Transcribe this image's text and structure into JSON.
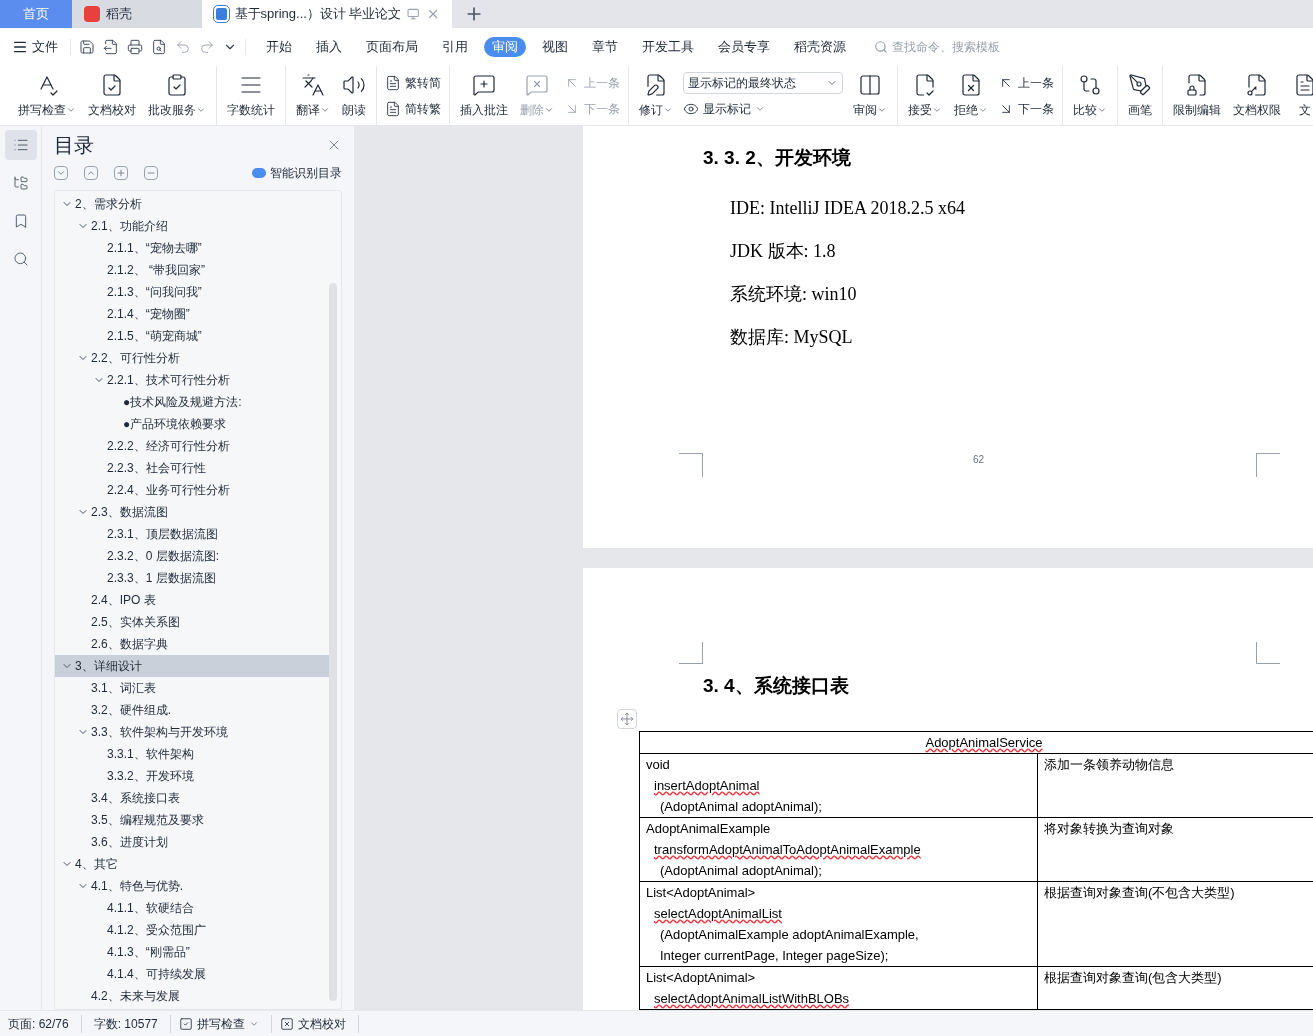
{
  "tabs": [
    {
      "kind": "home",
      "label": "首页",
      "selected": false
    },
    {
      "kind": "docer",
      "label": "稻壳",
      "selected": false
    },
    {
      "kind": "doc",
      "label": "基于spring...）设计 毕业论文",
      "selected": true
    }
  ],
  "menu": {
    "file": "文件",
    "tabs": [
      {
        "label": "开始",
        "selected": false
      },
      {
        "label": "插入",
        "selected": false
      },
      {
        "label": "页面布局",
        "selected": false
      },
      {
        "label": "引用",
        "selected": false
      },
      {
        "label": "审阅",
        "selected": true
      },
      {
        "label": "视图",
        "selected": false
      },
      {
        "label": "章节",
        "selected": false
      },
      {
        "label": "开发工具",
        "selected": false
      },
      {
        "label": "会员专享",
        "selected": false
      },
      {
        "label": "稻壳资源",
        "selected": false
      }
    ],
    "search": {
      "placeholder": "查找命令、搜索模板"
    }
  },
  "ribbon": [
    {
      "items": [
        {
          "kind": "large",
          "label": "拼写检查",
          "dropdown": true,
          "disabled": false
        },
        {
          "kind": "large",
          "label": "文档校对",
          "dropdown": false,
          "disabled": false
        },
        {
          "kind": "large",
          "label": "批改服务",
          "dropdown": true,
          "disabled": false
        }
      ]
    },
    {
      "items": [
        {
          "kind": "large",
          "label": "字数统计",
          "dropdown": false,
          "disabled": false
        }
      ]
    },
    {
      "items": [
        {
          "kind": "large",
          "label": "翻译",
          "dropdown": true,
          "disabled": false
        },
        {
          "kind": "large",
          "label": "朗读",
          "dropdown": false,
          "disabled": false
        }
      ]
    },
    {
      "items": [
        {
          "kind": "stack",
          "rows": [
            {
              "kind": "small",
              "label": "繁转简",
              "dropdown": false,
              "disabled": false
            },
            {
              "kind": "small",
              "label": "简转繁",
              "dropdown": false,
              "disabled": false
            }
          ]
        }
      ]
    },
    {
      "items": [
        {
          "kind": "large",
          "label": "插入批注",
          "dropdown": false,
          "disabled": false
        },
        {
          "kind": "large",
          "label": "删除",
          "dropdown": true,
          "disabled": true
        },
        {
          "kind": "stack",
          "rows": [
            {
              "kind": "small",
              "label": "上一条",
              "dropdown": false,
              "disabled": true
            },
            {
              "kind": "small",
              "label": "下一条",
              "dropdown": false,
              "disabled": true
            }
          ]
        }
      ]
    },
    {
      "items": [
        {
          "kind": "large",
          "label": "修订",
          "dropdown": true,
          "disabled": false
        },
        {
          "kind": "stack",
          "rows": [
            {
              "kind": "select",
              "value": "显示标记的最终状态"
            },
            {
              "kind": "small",
              "label": "显示标记",
              "dropdown": true,
              "disabled": false
            }
          ]
        },
        {
          "kind": "large",
          "label": "审阅",
          "dropdown": true,
          "disabled": false
        }
      ]
    },
    {
      "items": [
        {
          "kind": "large",
          "label": "接受",
          "dropdown": true,
          "disabled": false
        },
        {
          "kind": "large",
          "label": "拒绝",
          "dropdown": true,
          "disabled": false
        },
        {
          "kind": "stack",
          "rows": [
            {
              "kind": "small",
              "label": "上一条",
              "dropdown": false,
              "disabled": false
            },
            {
              "kind": "small",
              "label": "下一条",
              "dropdown": false,
              "disabled": false
            }
          ]
        }
      ]
    },
    {
      "items": [
        {
          "kind": "large",
          "label": "比较",
          "dropdown": true,
          "disabled": false
        }
      ]
    },
    {
      "items": [
        {
          "kind": "large",
          "label": "画笔",
          "dropdown": false,
          "disabled": false
        }
      ]
    },
    {
      "items": [
        {
          "kind": "large",
          "label": "限制编辑",
          "dropdown": false,
          "disabled": false
        },
        {
          "kind": "large",
          "label": "文档权限",
          "dropdown": false,
          "disabled": false
        },
        {
          "kind": "large",
          "label": "文",
          "dropdown": false,
          "disabled": false
        }
      ]
    }
  ],
  "rail": [
    {
      "selected": true
    },
    {
      "selected": false
    },
    {
      "selected": false
    },
    {
      "selected": false
    }
  ],
  "toc": {
    "title": "目录",
    "smart": "智能识别目录",
    "items": [
      {
        "label": "2、需求分析",
        "expanded": true,
        "selected": false,
        "children": [
          {
            "label": "2.1、功能介绍",
            "expanded": true,
            "selected": false,
            "children": [
              {
                "label": "2.1.1、“宠物去哪”",
                "selected": false
              },
              {
                "label": "2.1.2、 “带我回家”",
                "selected": false
              },
              {
                "label": "2.1.3、“问我问我”",
                "selected": false
              },
              {
                "label": "2.1.4、“宠物圈”",
                "selected": false
              },
              {
                "label": "2.1.5、“萌宠商城”",
                "selected": false
              }
            ]
          },
          {
            "label": "2.2、可行性分析",
            "expanded": true,
            "selected": false,
            "children": [
              {
                "label": "2.2.1、技术可行性分析",
                "expanded": true,
                "selected": false,
                "children": [
                  {
                    "label": "●技术风险及规避方法:",
                    "selected": false
                  },
                  {
                    "label": "●产品环境依赖要求",
                    "selected": false
                  }
                ]
              },
              {
                "label": "2.2.2、经济可行性分析",
                "selected": false
              },
              {
                "label": "2.2.3、社会可行性",
                "selected": false
              },
              {
                "label": "2.2.4、业务可行性分析",
                "selected": false
              }
            ]
          },
          {
            "label": "2.3、数据流图",
            "expanded": true,
            "selected": false,
            "children": [
              {
                "label": "2.3.1、顶层数据流图",
                "selected": false
              },
              {
                "label": "2.3.2、0 层数据流图:",
                "selected": false
              },
              {
                "label": "2.3.3、1 层数据流图",
                "selected": false
              }
            ]
          },
          {
            "label": "2.4、IPO 表",
            "selected": false
          },
          {
            "label": "2.5、实体关系图",
            "selected": false
          },
          {
            "label": "2.6、数据字典",
            "selected": false
          }
        ]
      },
      {
        "label": "3、详细设计",
        "expanded": true,
        "selected": true,
        "children": [
          {
            "label": "3.1、词汇表",
            "selected": false
          },
          {
            "label": "3.2、硬件组成.",
            "selected": false
          },
          {
            "label": "3.3、软件架构与开发环境",
            "expanded": true,
            "selected": false,
            "children": [
              {
                "label": "3.3.1、软件架构",
                "selected": false
              },
              {
                "label": "3.3.2、开发环境",
                "selected": false
              }
            ]
          },
          {
            "label": "3.4、系统接口表",
            "selected": false
          },
          {
            "label": "3.5、编程规范及要求",
            "selected": false
          },
          {
            "label": "3.6、进度计划",
            "selected": false
          }
        ]
      },
      {
        "label": "4、其它",
        "expanded": true,
        "selected": false,
        "children": [
          {
            "label": "4.1、特色与优势.",
            "expanded": true,
            "selected": false,
            "children": [
              {
                "label": "4.1.1、软硬结合",
                "selected": false
              },
              {
                "label": "4.1.2、受众范围广",
                "selected": false
              },
              {
                "label": "4.1.3、“刚需品”",
                "selected": false
              },
              {
                "label": "4.1.4、可持续发展",
                "selected": false
              }
            ]
          },
          {
            "label": "4.2、未来与发展",
            "selected": false
          }
        ]
      }
    ]
  },
  "page1": {
    "heading": "3. 3. 2、开发环境",
    "lines": [
      "IDE: IntelliJ IDEA 2018.2.5 x64",
      "JDK 版本: 1.8",
      "系统环境: win10",
      "数据库: MySQL"
    ],
    "page_number": "62"
  },
  "page2": {
    "heading": "3. 4、系统接口表",
    "table": {
      "title": "AdoptAnimalService",
      "rows": [
        {
          "signature": [
            "void",
            "insertAdoptAnimal",
            "(AdoptAnimal adoptAnimal);"
          ],
          "description": "添加一条领养动物信息"
        },
        {
          "signature": [
            "AdoptAnimalExample",
            "transformAdoptAnimalToAdoptAnimalExample",
            "(AdoptAnimal adoptAnimal);"
          ],
          "description": "将对象转换为查询对象"
        },
        {
          "signature": [
            "List<AdoptAnimal>",
            "selectAdoptAnimalList",
            "(AdoptAnimalExample adoptAnimalExample,",
            "Integer currentPage, Integer pageSize);"
          ],
          "description": "根据查询对象查询(不包含大类型)"
        },
        {
          "signature": [
            "List<AdoptAnimal>",
            "selectAdoptAnimalListWithBLOBs"
          ],
          "description": "根据查询对象查询(包含大类型)"
        }
      ]
    }
  },
  "status": {
    "page": "页面: 62/76",
    "words": "字数: 10577",
    "spell": "拼写检查",
    "proof": "文档校对"
  }
}
